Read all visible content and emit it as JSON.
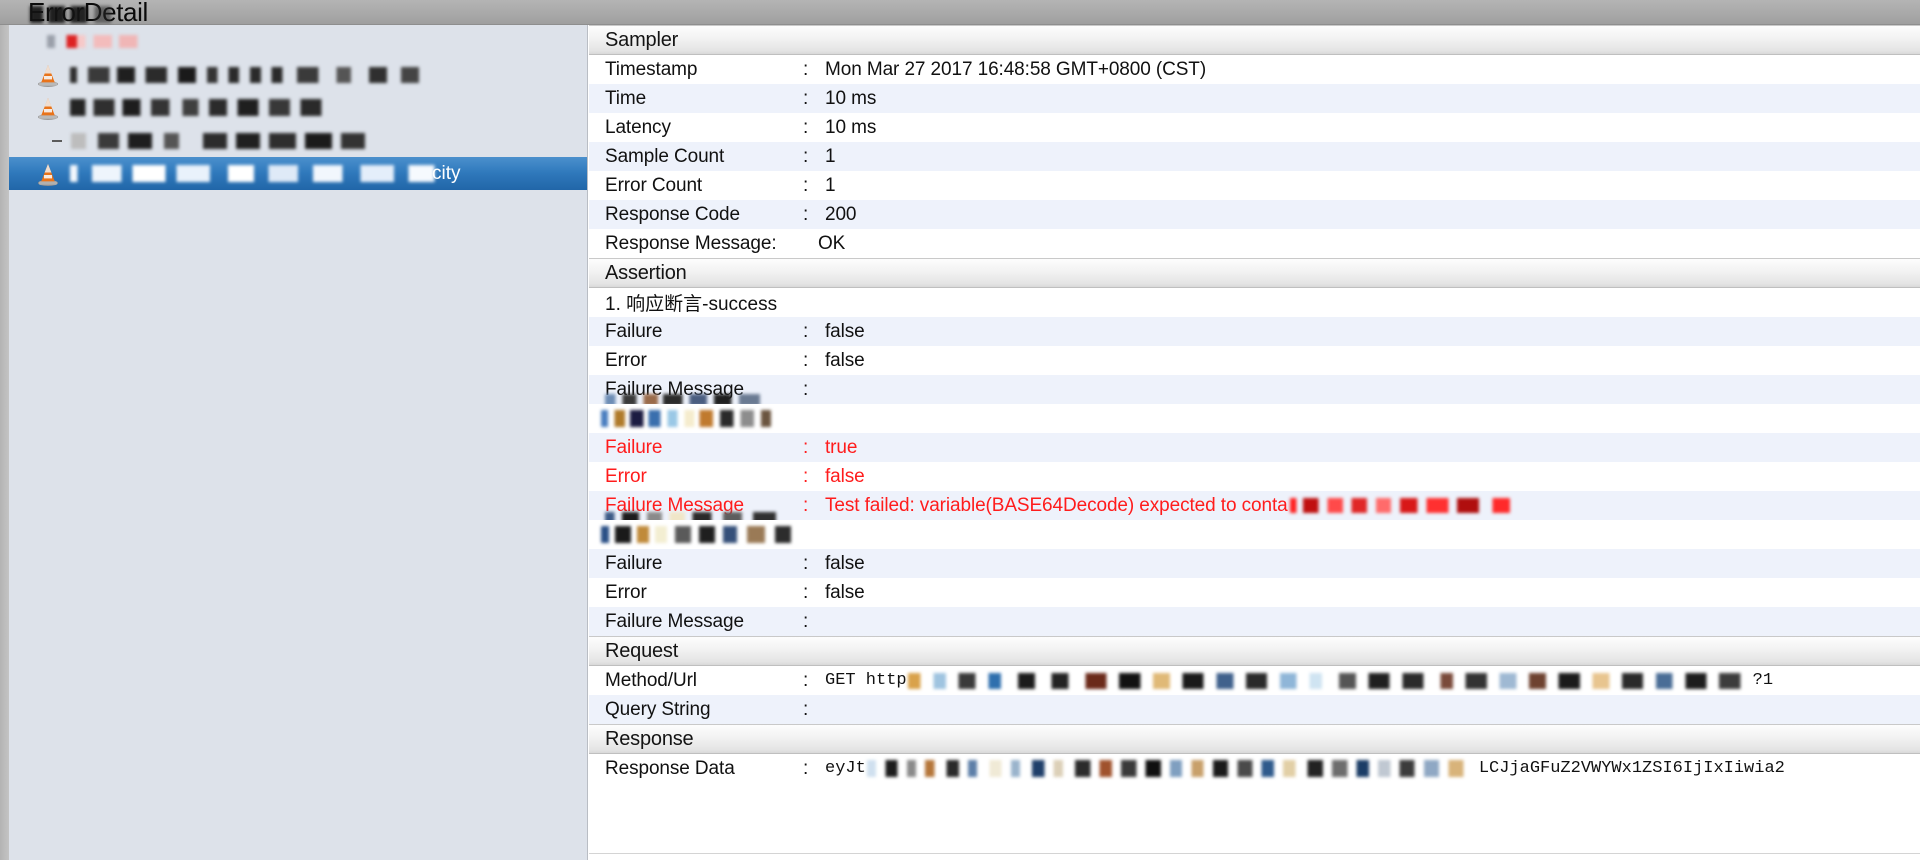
{
  "window": {
    "title": "ErrorDetail"
  },
  "sidebar": {
    "items": [
      {
        "label": "",
        "icon": "none",
        "redacted": true,
        "depth": 0,
        "selected": false,
        "handle": "none"
      },
      {
        "label": "",
        "icon": "cone-icon",
        "redacted": true,
        "depth": 1,
        "selected": false,
        "handle": "none"
      },
      {
        "label": "",
        "icon": "cone-icon",
        "redacted": true,
        "depth": 1,
        "selected": false,
        "handle": "none"
      },
      {
        "label": "",
        "icon": "none",
        "redacted": true,
        "depth": 2,
        "selected": false,
        "handle": "dash"
      },
      {
        "label": "city",
        "icon": "cone-icon",
        "redacted": true,
        "depth": 1,
        "selected": true,
        "handle": "none"
      }
    ]
  },
  "detail": {
    "sections": [
      {
        "header": "Sampler",
        "rows": [
          {
            "key": "Timestamp",
            "sep": ":",
            "value": "Mon Mar 27 2017 16:48:58 GMT+0800 (CST)",
            "fail": false,
            "mono": false
          },
          {
            "key": "Time",
            "sep": ":",
            "value": "10 ms",
            "fail": false,
            "mono": false
          },
          {
            "key": "Latency",
            "sep": ":",
            "value": "10 ms",
            "fail": false,
            "mono": false
          },
          {
            "key": "Sample Count",
            "sep": ":",
            "value": "1",
            "fail": false,
            "mono": false
          },
          {
            "key": "Error Count",
            "sep": ":",
            "value": "1",
            "fail": false,
            "mono": false
          },
          {
            "key": "Response Code",
            "sep": ":",
            "value": "200",
            "fail": false,
            "mono": false
          },
          {
            "key": "Response Message:",
            "sep": "",
            "value": "OK",
            "fail": false,
            "mono": false
          }
        ]
      },
      {
        "header": "Assertion",
        "assertions": [
          {
            "title": "1. 响应断言-success",
            "title_redacted": false,
            "rows": [
              {
                "key": "Failure",
                "sep": ":",
                "value": "false",
                "fail": false
              },
              {
                "key": "Error",
                "sep": ":",
                "value": "false",
                "fail": false
              },
              {
                "key": "Failure Message",
                "sep": ":",
                "value": "",
                "fail": false
              }
            ]
          },
          {
            "title": "",
            "title_redacted": true,
            "rows": [
              {
                "key": "Failure",
                "sep": ":",
                "value": "true",
                "fail": true
              },
              {
                "key": "Error",
                "sep": ":",
                "value": "false",
                "fail": true
              },
              {
                "key": "Failure Message",
                "sep": ":",
                "value": "Test failed: variable(BASE64Decode) expected to conta",
                "fail": true,
                "truncated_redacted": true
              }
            ]
          },
          {
            "title": "",
            "title_redacted": true,
            "rows": [
              {
                "key": "Failure",
                "sep": ":",
                "value": "false",
                "fail": false
              },
              {
                "key": "Error",
                "sep": ":",
                "value": "false",
                "fail": false
              },
              {
                "key": "Failure Message",
                "sep": ":",
                "value": "",
                "fail": false
              }
            ]
          }
        ]
      },
      {
        "header": "Request",
        "rows": [
          {
            "key": "Method/Url",
            "sep": ":",
            "value": "GET http",
            "fail": false,
            "mono": true,
            "redacted_tail": true,
            "tail_text": "?1"
          },
          {
            "key": "Query String",
            "sep": ":",
            "value": "",
            "fail": false,
            "mono": false
          }
        ]
      },
      {
        "header": "Response",
        "rows": [
          {
            "key": "Response Data",
            "sep": ":",
            "value": "eyJt",
            "fail": false,
            "mono": true,
            "redacted_tail": true,
            "tail_text": "LCJjaGFuZ2VWYWx1ZSI6IjIxIiwia2"
          }
        ]
      }
    ]
  },
  "colors": {
    "title_bar": "#a9a9a9",
    "sidebar_bg": "#dde2ea",
    "selection_blue": "#2f79bc",
    "row_alt": "#eef2fb",
    "fail_red": "#ff1c1c",
    "text": "#111111"
  }
}
